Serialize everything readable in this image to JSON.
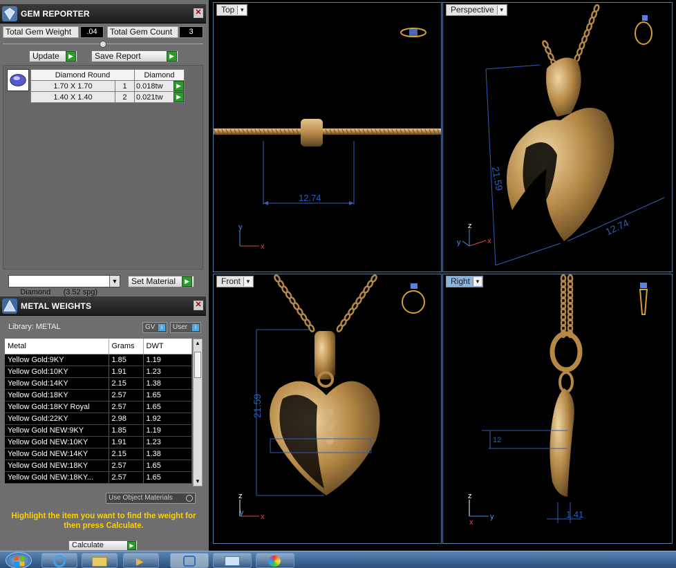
{
  "gem_reporter": {
    "title": "GEM REPORTER",
    "close": "✕",
    "total_weight_label": "Total Gem Weight",
    "total_weight_value": ".04",
    "total_count_label": "Total Gem Count",
    "total_count_value": "3",
    "update_label": "Update",
    "save_report_label": "Save Report",
    "table_headers": [
      "Diamond Round",
      "Diamond"
    ],
    "rows": [
      {
        "size": "1.70 X 1.70",
        "qty": "1",
        "weight": "0.018tw"
      },
      {
        "size": "1.40 X 1.40",
        "qty": "2",
        "weight": "0.021tw"
      }
    ],
    "material_select": "Diamond      (3.52 spg)",
    "set_material_label": "Set Material"
  },
  "metal_weights": {
    "title": "METAL WEIGHTS",
    "close": "✕",
    "library_label": "Library: METAL",
    "gv_label": "GV",
    "user_label": "User",
    "columns": [
      "Metal",
      "Grams",
      "DWT"
    ],
    "rows": [
      {
        "metal": "Yellow Gold:9KY",
        "grams": "1.85",
        "dwt": "1.19"
      },
      {
        "metal": "Yellow Gold:10KY",
        "grams": "1.91",
        "dwt": "1.23"
      },
      {
        "metal": "Yellow Gold:14KY",
        "grams": "2.15",
        "dwt": "1.38"
      },
      {
        "metal": "Yellow Gold:18KY",
        "grams": "2.57",
        "dwt": "1.65"
      },
      {
        "metal": "Yellow Gold:18KY Royal",
        "grams": "2.57",
        "dwt": "1.65"
      },
      {
        "metal": "Yellow Gold:22KY",
        "grams": "2.98",
        "dwt": "1.92"
      },
      {
        "metal": "Yellow Gold NEW:9KY",
        "grams": "1.85",
        "dwt": "1.19"
      },
      {
        "metal": "Yellow Gold NEW:10KY",
        "grams": "1.91",
        "dwt": "1.23"
      },
      {
        "metal": "Yellow Gold NEW:14KY",
        "grams": "2.15",
        "dwt": "1.38"
      },
      {
        "metal": "Yellow Gold NEW:18KY",
        "grams": "2.57",
        "dwt": "1.65"
      },
      {
        "metal": "Yellow Gold NEW:18KY...",
        "grams": "2.57",
        "dwt": "1.65"
      }
    ],
    "use_object_materials": "Use Object Materials",
    "hint": "Highlight the item you want to find the weight for then press Calculate.",
    "calculate_label": "Calculate"
  },
  "viewports": {
    "top": {
      "label": "Top",
      "dim_width": "12.74"
    },
    "perspective": {
      "label": "Perspective",
      "dim_height": "21.59",
      "dim_width": "12.74"
    },
    "front": {
      "label": "Front",
      "dim_height": "21.59"
    },
    "right": {
      "label": "Right",
      "dim_small": "1.41",
      "dim_side": "12"
    }
  },
  "axes": {
    "x": "x",
    "y": "y",
    "z": "z"
  },
  "colors": {
    "gold": "#c9a060",
    "gold_dark": "#7a5a2c",
    "dimension": "#2f5fb8",
    "hint_text": "#ffd000",
    "active_tab": "#8fb4dc"
  }
}
